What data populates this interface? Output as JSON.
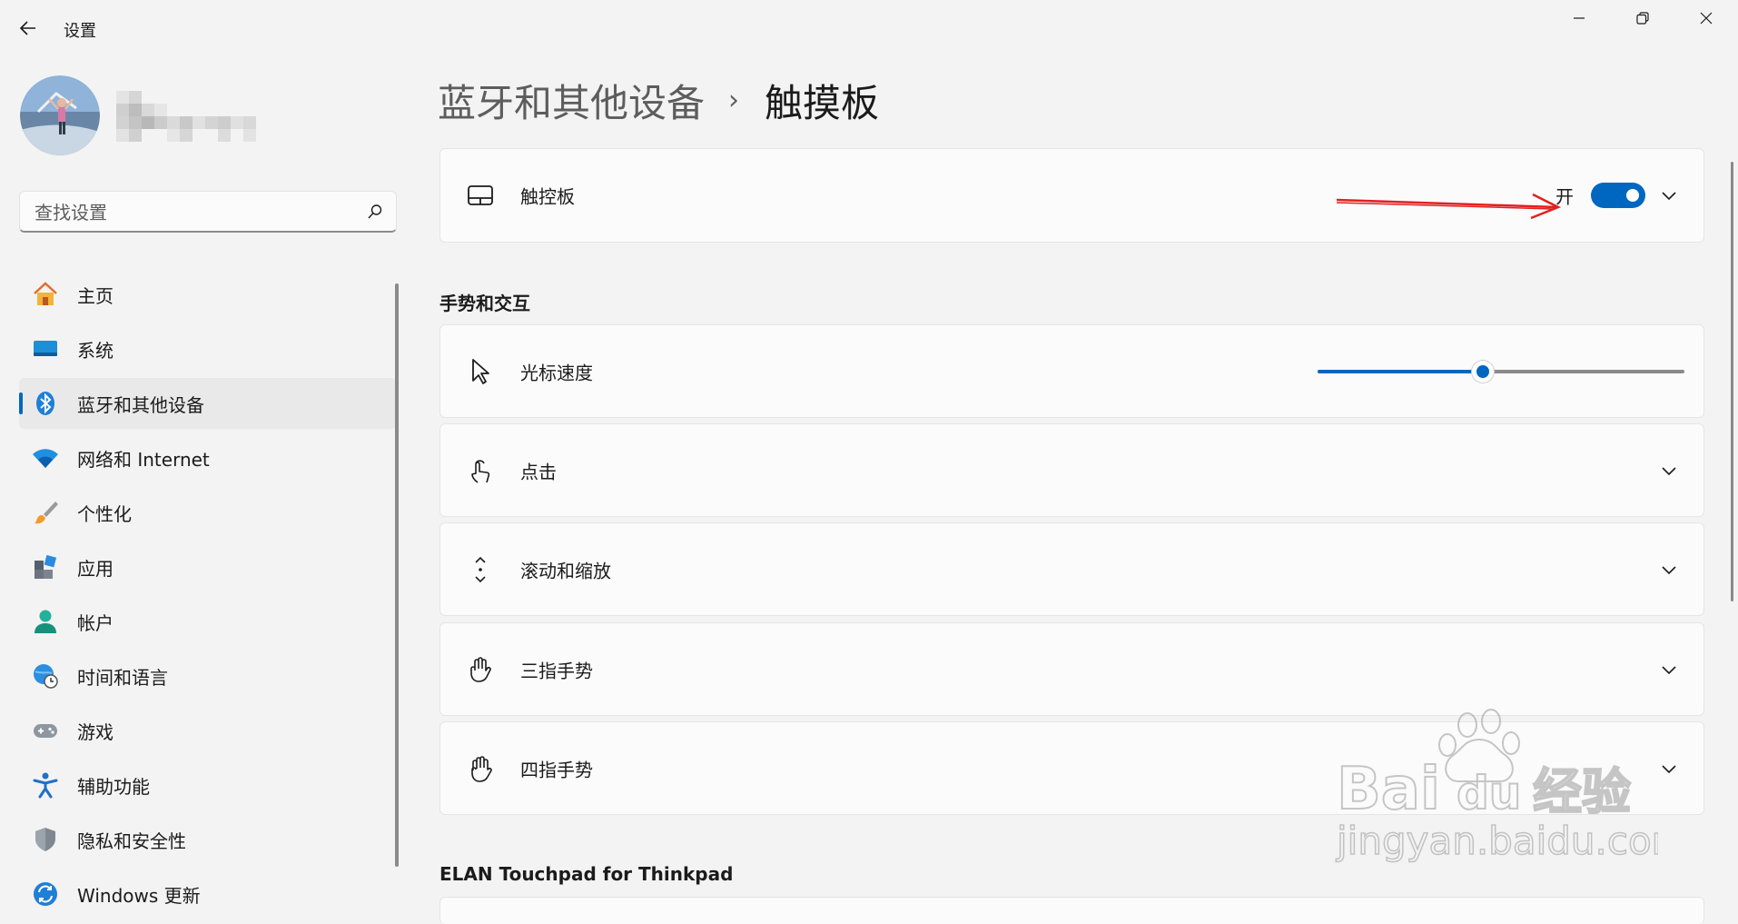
{
  "window": {
    "title": "设置",
    "controls": {
      "minimize": "minimize-icon",
      "maximize": "restore-icon",
      "close": "close-icon"
    }
  },
  "user": {
    "avatar": "user-avatar-photo",
    "name_blurred": true
  },
  "search": {
    "placeholder": "查找设置",
    "value": ""
  },
  "sidebar": {
    "items": [
      {
        "label": "主页",
        "icon": "home-icon",
        "selected": false
      },
      {
        "label": "系统",
        "icon": "system-icon",
        "selected": false
      },
      {
        "label": "蓝牙和其他设备",
        "icon": "bluetooth-icon",
        "selected": true
      },
      {
        "label": "网络和 Internet",
        "icon": "wifi-icon",
        "selected": false
      },
      {
        "label": "个性化",
        "icon": "brush-icon",
        "selected": false
      },
      {
        "label": "应用",
        "icon": "apps-icon",
        "selected": false
      },
      {
        "label": "帐户",
        "icon": "account-icon",
        "selected": false
      },
      {
        "label": "时间和语言",
        "icon": "globe-clock-icon",
        "selected": false
      },
      {
        "label": "游戏",
        "icon": "gamepad-icon",
        "selected": false
      },
      {
        "label": "辅助功能",
        "icon": "accessibility-icon",
        "selected": false
      },
      {
        "label": "隐私和安全性",
        "icon": "shield-icon",
        "selected": false
      },
      {
        "label": "Windows 更新",
        "icon": "update-icon",
        "selected": false
      }
    ]
  },
  "breadcrumb": {
    "parent": "蓝牙和其他设备",
    "separator": "›",
    "current": "触摸板"
  },
  "touchpad": {
    "label": "触控板",
    "icon": "touchpad-icon",
    "state_label": "开",
    "enabled": true
  },
  "gestures_section": {
    "title": "手势和交互",
    "cursor_speed": {
      "label": "光标速度",
      "icon": "cursor-icon",
      "value_fraction": 0.45
    },
    "items": [
      {
        "label": "点击",
        "icon": "tap-icon"
      },
      {
        "label": "滚动和缩放",
        "icon": "scroll-icon"
      },
      {
        "label": "三指手势",
        "icon": "three-finger-hand-icon"
      },
      {
        "label": "四指手势",
        "icon": "four-finger-hand-icon"
      }
    ]
  },
  "device_section": {
    "title": "ELAN Touchpad for Thinkpad"
  },
  "watermark": {
    "brand": "Bai",
    "brand_suffix": "du",
    "cn": "经验",
    "url": "jingyan.baidu.com"
  },
  "colors": {
    "accent": "#0067c0",
    "annotation_arrow": "#e02020",
    "background": "#f3f3f3",
    "card": "#fbfbfb"
  }
}
